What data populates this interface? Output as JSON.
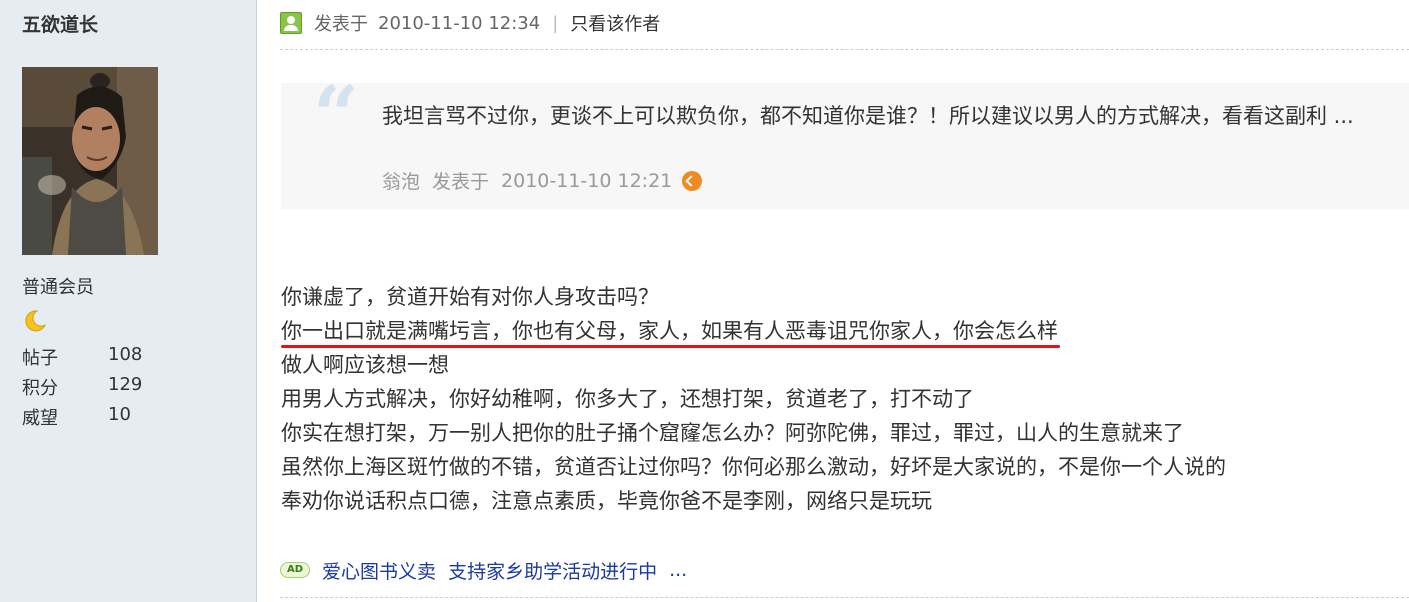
{
  "user": {
    "name": "五欲道长",
    "group": "普通会员",
    "rank_icon": "moon-icon",
    "stats": [
      {
        "label": "帖子",
        "value": "108"
      },
      {
        "label": "积分",
        "value": "129"
      },
      {
        "label": "威望",
        "value": "10"
      }
    ]
  },
  "post": {
    "posted_label": "发表于",
    "posted_time": "2010-11-10 12:34",
    "separator": "|",
    "author_only_label": "只看该作者",
    "quote": {
      "text": "我坦言骂不过你，更谈不上可以欺负你，都不知道你是谁？！所以建议以男人的方式解决，看看这副利 ...",
      "author": "翁泡",
      "posted_label": "发表于",
      "posted_time": "2010-11-10 12:21"
    },
    "lines": [
      "你谦虚了，贫道开始有对你人身攻击吗？",
      "你一出口就是满嘴圬言，你也有父母，家人，如果有人恶毒诅咒你家人，你会怎么样",
      "做人啊应该想一想",
      "用男人方式解决，你好幼稚啊，你多大了，还想打架，贫道老了，打不动了",
      "你实在想打架，万一别人把你的肚子捅个窟窿怎么办？阿弥陀佛，罪过，罪过，山人的生意就来了",
      "虽然你上海区斑竹做的不错，贫道否让过你吗？你何必那么激动，好坏是大家说的，不是你一个人说的",
      "奉劝你说话积点口德，注意点素质，毕竟你爸不是李刚，网络只是玩玩"
    ]
  },
  "ad": {
    "badge": "AD",
    "link1": "爱心图书义卖",
    "link2": "支持家乡助学活动进行中",
    "more": "..."
  },
  "colors": {
    "sidebar_bg": "#e5edf2",
    "quote_bg": "#f7f7f7",
    "underline": "#e0151b",
    "ad_link": "#1a3a9c",
    "jump_icon": "#f08a24"
  }
}
